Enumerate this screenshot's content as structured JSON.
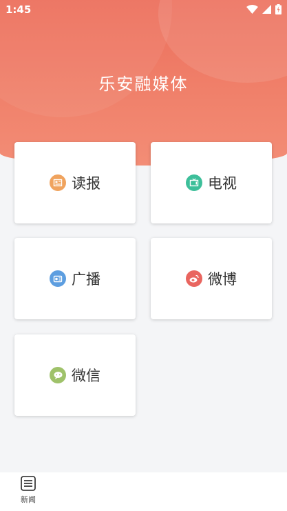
{
  "status_bar": {
    "time": "1:45",
    "icons": [
      "wifi-icon",
      "signal-icon",
      "battery-charging-icon"
    ]
  },
  "header": {
    "title": "乐安融媒体"
  },
  "colors": {
    "header": "#ef7b66",
    "reading": "#f0a35e",
    "tv": "#3dbf9a",
    "radio": "#5d9ee0",
    "weibo": "#e9655f",
    "wechat": "#9fc26a"
  },
  "menu": {
    "reading": {
      "label": "读报",
      "icon": "newspaper-icon"
    },
    "tv": {
      "label": "电视",
      "icon": "tv-icon"
    },
    "radio": {
      "label": "广播",
      "icon": "radio-icon"
    },
    "weibo": {
      "label": "微博",
      "icon": "weibo-icon"
    },
    "wechat": {
      "label": "微信",
      "icon": "wechat-icon"
    }
  },
  "bottom_nav": {
    "items": [
      {
        "label": "新闻",
        "icon": "news-list-icon"
      }
    ]
  }
}
